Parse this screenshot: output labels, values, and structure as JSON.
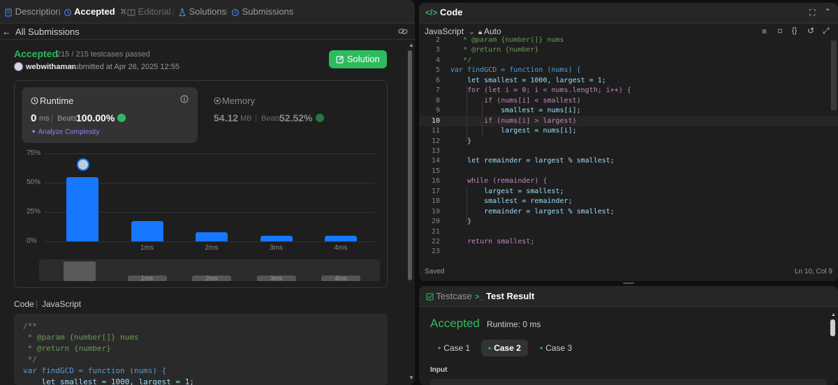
{
  "left_tabs": {
    "description": "Description",
    "accepted": "Accepted",
    "editorial": "Editorial",
    "solutions": "Solutions",
    "submissions": "Submissions"
  },
  "back_label": "All Submissions",
  "result": {
    "status": "Accepted",
    "testcases": "215 / 215 testcases passed",
    "username": "webwithaman",
    "submitted": "submitted at Apr 26, 2025 12:55",
    "solution_button": "Solution"
  },
  "runtime": {
    "title": "Runtime",
    "value": "0",
    "unit": "ms",
    "beats_label": "Beats",
    "beats_value": "100.00%",
    "analyze": "Analyze Complexity"
  },
  "memory": {
    "title": "Memory",
    "value": "54.12",
    "unit": "MB",
    "beats_label": "Beats",
    "beats_value": "52.52%"
  },
  "chart_data": {
    "type": "bar",
    "categories": [
      "0ms",
      "1ms",
      "2ms",
      "3ms",
      "4ms"
    ],
    "tick_labels": [
      "",
      "1ms",
      "2ms",
      "3ms",
      "4ms"
    ],
    "values": [
      55,
      17,
      8,
      5,
      5
    ],
    "yticks": [
      "75%",
      "50%",
      "25%",
      "0%"
    ],
    "ylim": [
      0,
      75
    ],
    "bar_color": "#1677ff"
  },
  "code_section": {
    "label": "Code",
    "lang": "JavaScript",
    "lines": [
      "/**",
      " * @param {number[]} nums",
      " * @return {number}",
      " */",
      "var findGCD = function (nums) {",
      "    let smallest = 1000, largest = 1;"
    ]
  },
  "editor": {
    "title": "Code",
    "language": "JavaScript",
    "auto_label": "Auto",
    "status_left": "Saved",
    "status_right": "Ln 10, Col 9",
    "line_numbers": [
      "2",
      "3",
      "4",
      "5",
      "6",
      "7",
      "8",
      "9",
      "10",
      "11",
      "12",
      "13",
      "14",
      "15",
      "16",
      "17",
      "18",
      "19",
      "20",
      "21",
      "22",
      "23"
    ],
    "lines": [
      "   * @param {number[]} nums",
      "   * @return {number}",
      "   */",
      "var findGCD = function (nums) {",
      "    let smallest = 1000, largest = 1;",
      "    for (let i = 0; i < nums.length; i++) {",
      "        if (nums[i] < smallest)",
      "            smallest = nums[i];",
      "        if (nums[i] > largest)",
      "            largest = nums[i];",
      "    }",
      "",
      "    let remainder = largest % smallest;",
      "",
      "    while (remainder) {",
      "        largest = smallest;",
      "        smallest = remainder;",
      "        remainder = largest % smallest;",
      "    }",
      "",
      "    return smallest;",
      ""
    ]
  },
  "test_panel": {
    "tab_testcase": "Testcase",
    "tab_result": "Test Result",
    "status": "Accepted",
    "runtime": "Runtime: 0 ms",
    "cases": [
      "Case 1",
      "Case 2",
      "Case 3"
    ],
    "input_label": "Input"
  },
  "colors": {
    "accent_green": "#2cbb5d",
    "accent_blue": "#1677ff",
    "bg_panel": "#1e1e1e"
  }
}
